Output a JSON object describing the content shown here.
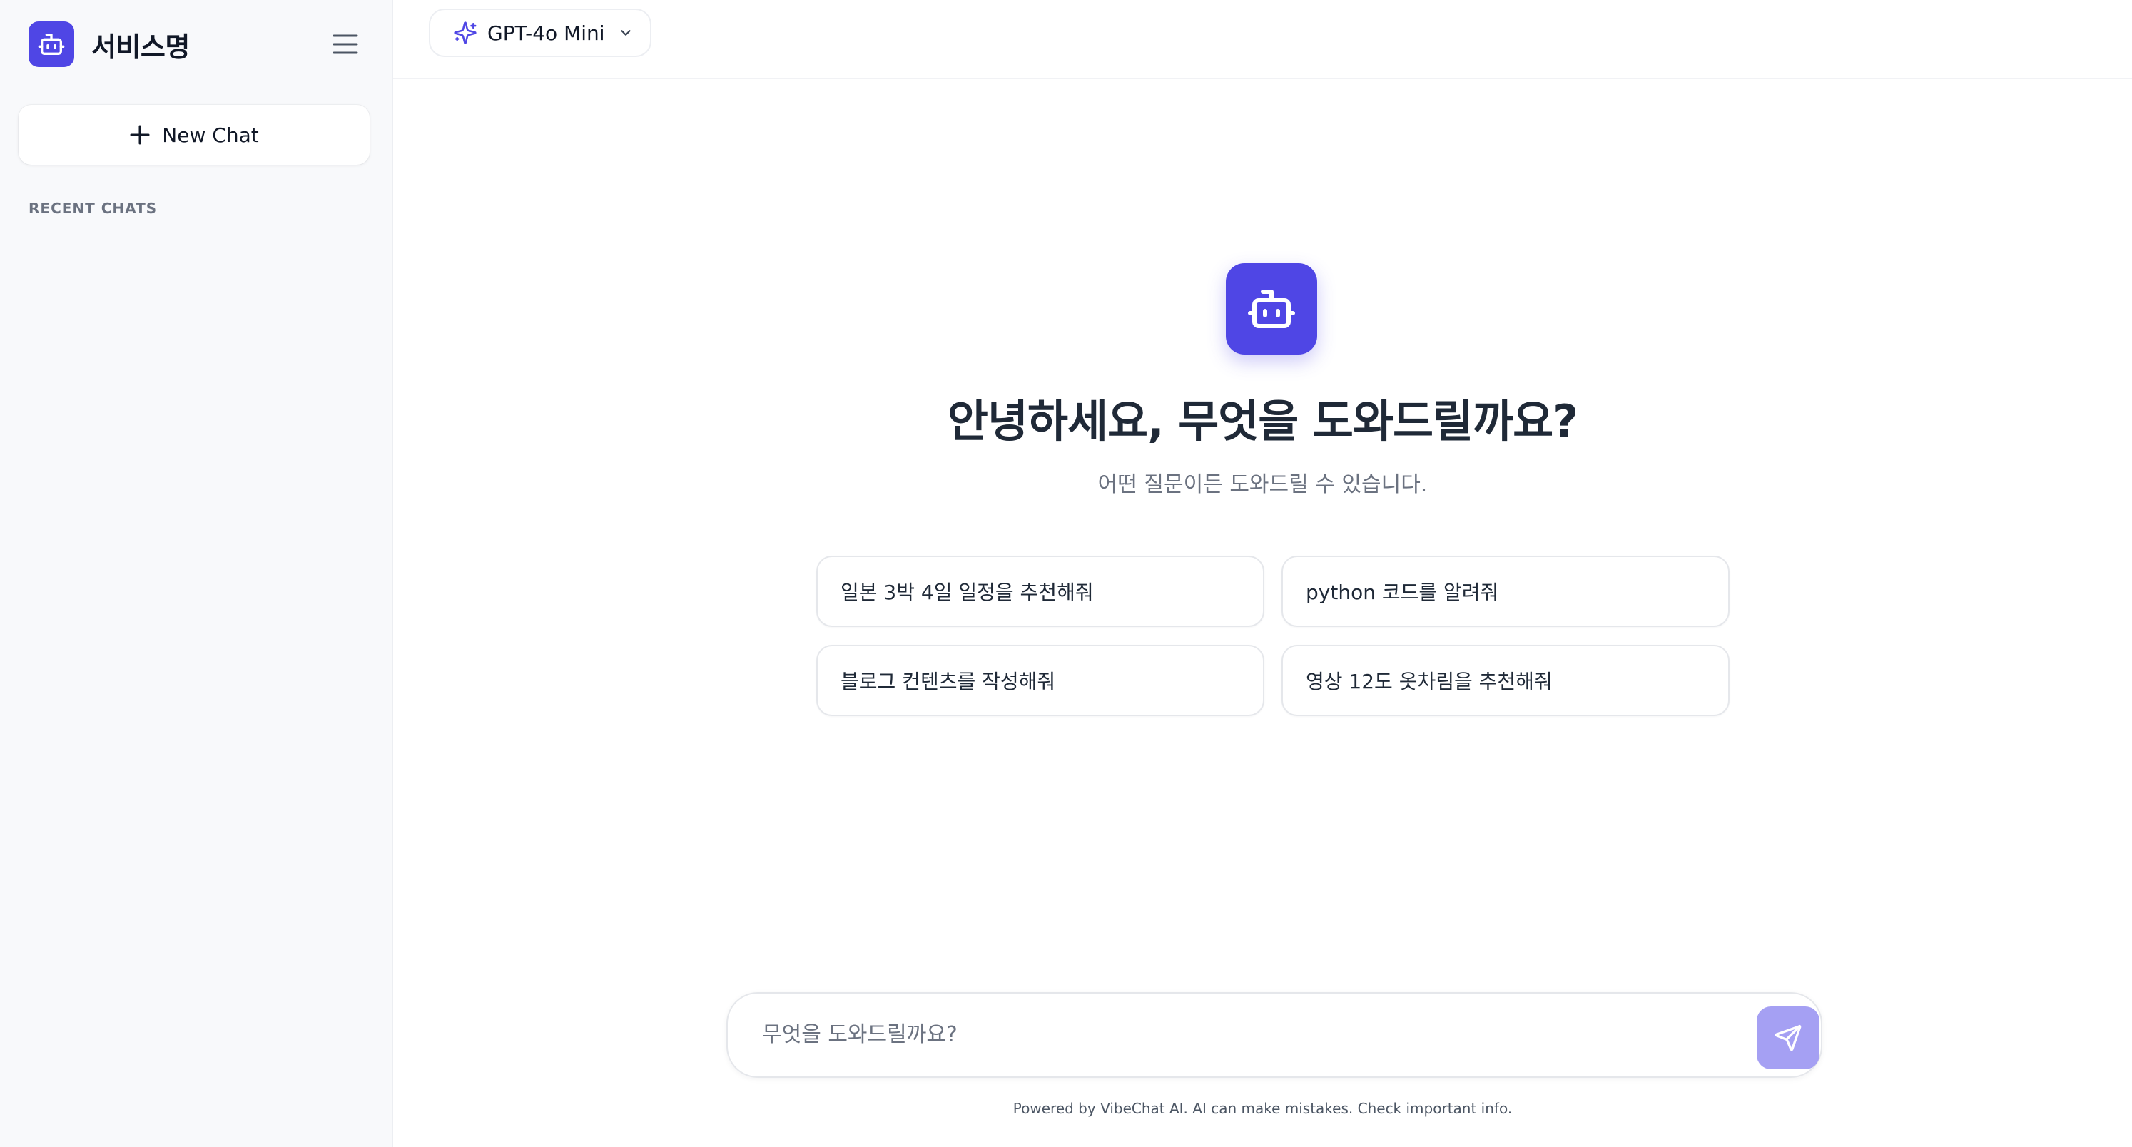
{
  "sidebar": {
    "brand_name": "서비스명",
    "new_chat_label": "New Chat",
    "recent_label": "RECENT CHATS"
  },
  "header": {
    "model_name": "GPT-4o Mini"
  },
  "hero": {
    "title": "안녕하세요, 무엇을 도와드릴까요?",
    "subtitle": "어떤 질문이든 도와드릴 수 있습니다."
  },
  "suggestions": [
    "일본 3박 4일 일정을 추천해줘",
    "python 코드를 알려줘",
    "블로그 컨텐츠를 작성해줘",
    "영상 12도 옷차림을 추천해줘"
  ],
  "composer": {
    "placeholder": "무엇을 도와드릴까요?",
    "value": ""
  },
  "footer": {
    "note": "Powered by VibeChat AI. AI can make mistakes. Check important info."
  },
  "icons": {
    "brand": "bot-icon",
    "menu": "menu-icon",
    "new_chat": "plus-icon",
    "model": "sparkles-icon",
    "model_dropdown": "chevron-down-icon",
    "hero": "bot-icon",
    "send": "send-icon"
  },
  "colors": {
    "accent": "#4f46e5",
    "send_button": "#a5a0f3",
    "sidebar_bg": "#f8f9fb"
  }
}
